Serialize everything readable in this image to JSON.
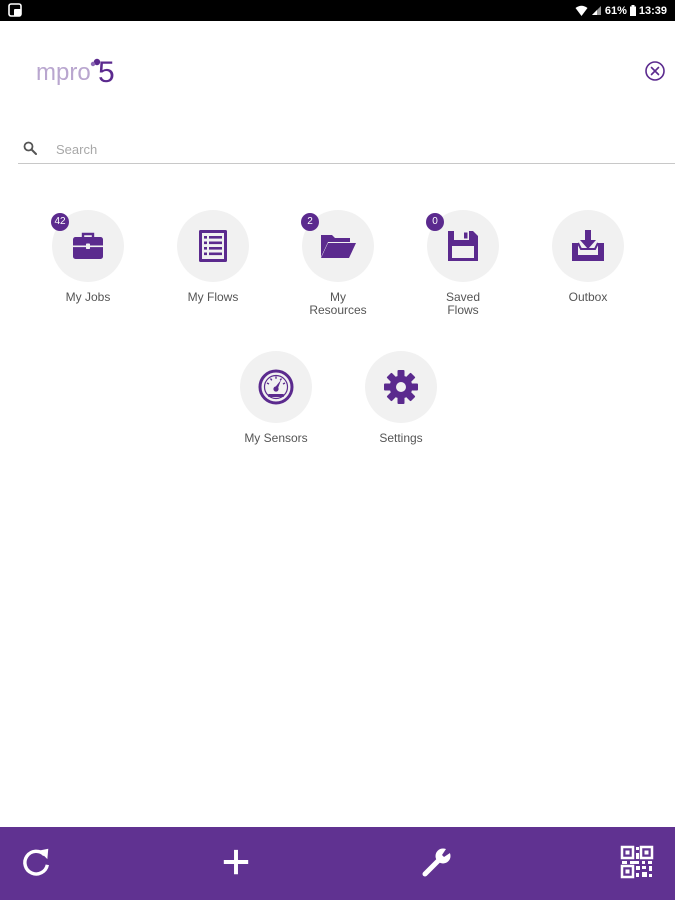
{
  "status_bar": {
    "battery": "61%",
    "time": "13:39",
    "icons": [
      "app-notification-icon",
      "wifi-icon",
      "signal-icon",
      "battery-icon"
    ]
  },
  "header": {
    "logo_text_main": "mpro",
    "logo_text_accent": "5",
    "close_icon": "close-circle-icon"
  },
  "search": {
    "placeholder": "Search",
    "value": "",
    "icon": "search-icon"
  },
  "tiles": [
    {
      "id": "my-jobs",
      "label": "My Jobs",
      "badge": "42",
      "icon": "briefcase-icon"
    },
    {
      "id": "my-flows",
      "label": "My Flows",
      "badge": "",
      "icon": "list-document-icon"
    },
    {
      "id": "my-resources",
      "label": "My\nResources",
      "badge": "2",
      "icon": "folder-open-icon"
    },
    {
      "id": "saved-flows",
      "label": "Saved\nFlows",
      "badge": "0",
      "icon": "floppy-disk-icon"
    },
    {
      "id": "outbox",
      "label": "Outbox",
      "badge": "",
      "icon": "inbox-download-icon"
    },
    {
      "id": "my-sensors",
      "label": "My Sensors",
      "badge": "",
      "icon": "gauge-icon"
    },
    {
      "id": "settings",
      "label": "Settings",
      "badge": "",
      "icon": "gear-icon"
    }
  ],
  "bottom_bar": {
    "buttons": [
      "refresh-icon",
      "plus-icon",
      "wrench-icon",
      "qr-code-icon"
    ]
  },
  "colors": {
    "accent": "#5b2a8e",
    "bottom_bar": "#603291",
    "tile_background": "#f1f1f1",
    "label_text": "#555555"
  }
}
